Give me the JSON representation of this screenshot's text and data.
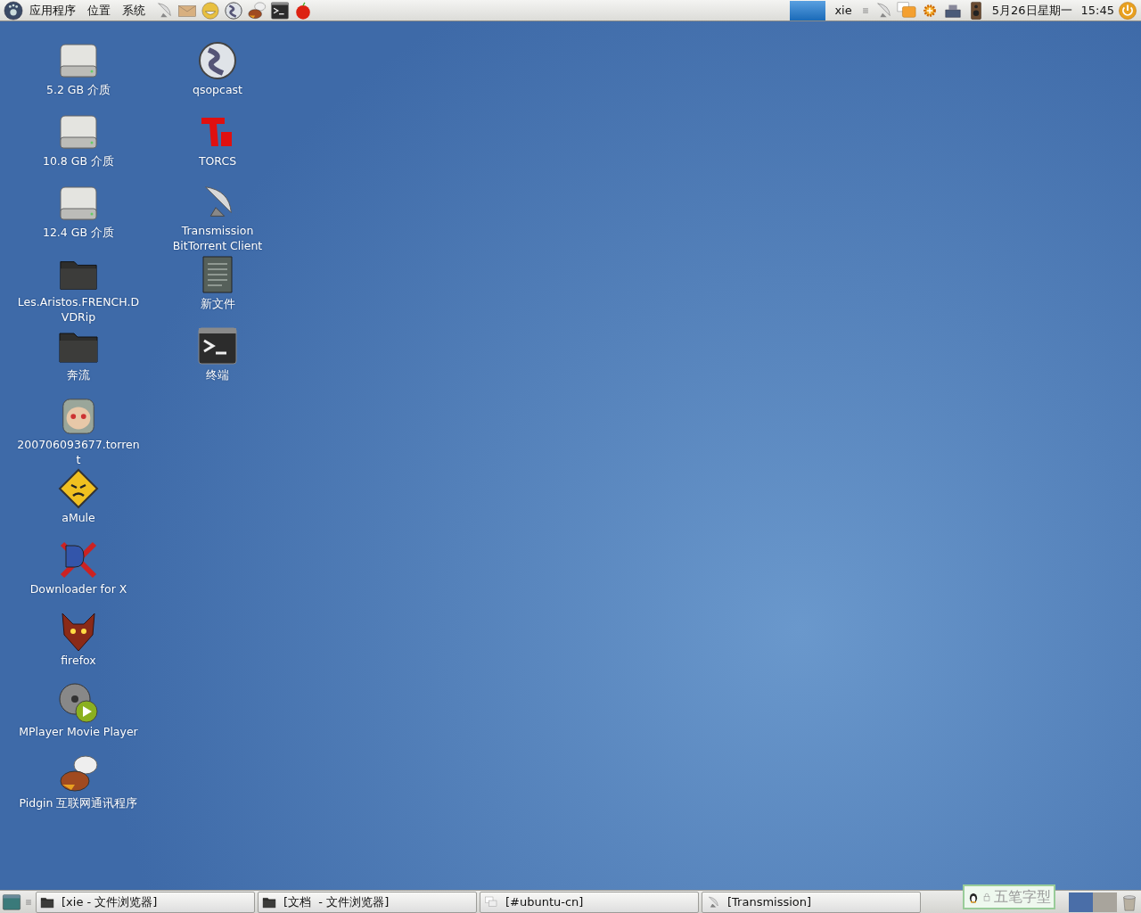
{
  "top_panel": {
    "menus": [
      "应用程序",
      "位置",
      "系统"
    ],
    "user": "xie",
    "date": "5月26日星期一",
    "time": "15:45"
  },
  "desktop_icons": [
    [
      {
        "kind": "drive",
        "label": "5.2 GB 介质"
      },
      {
        "kind": "drive",
        "label": "10.8 GB 介质"
      },
      {
        "kind": "drive",
        "label": "12.4 GB 介质"
      },
      {
        "kind": "folder",
        "label": "Les.Aristos.FRENCH.DVDRip"
      },
      {
        "kind": "folder",
        "label": "奔流"
      },
      {
        "kind": "torrent",
        "label": "200706093677.torrent"
      },
      {
        "kind": "amule",
        "label": "aMule"
      },
      {
        "kind": "dx",
        "label": "Downloader for X"
      },
      {
        "kind": "fox",
        "label": "firefox"
      },
      {
        "kind": "player",
        "label": "MPlayer Movie Player"
      },
      {
        "kind": "pidgin",
        "label": "Pidgin 互联网通讯程序"
      }
    ],
    [
      {
        "kind": "reel",
        "label": "qsopcast"
      },
      {
        "kind": "torcs",
        "label": "TORCS"
      },
      {
        "kind": "dish",
        "label": "Transmission BitTorrent Client"
      },
      {
        "kind": "document",
        "label": "新文件"
      },
      {
        "kind": "terminal",
        "label": "终端"
      }
    ]
  ],
  "taskbar": [
    {
      "kind": "folder",
      "label": "[xie - 文件浏览器]"
    },
    {
      "kind": "folder",
      "label": "[文档  - 文件浏览器]"
    },
    {
      "kind": "chat",
      "label": "[#ubuntu-cn]"
    },
    {
      "kind": "dish",
      "label": "[Transmission]"
    }
  ],
  "input_method": "五笔字型",
  "workspaces": [
    {
      "selected": true
    },
    {
      "selected": false
    }
  ]
}
